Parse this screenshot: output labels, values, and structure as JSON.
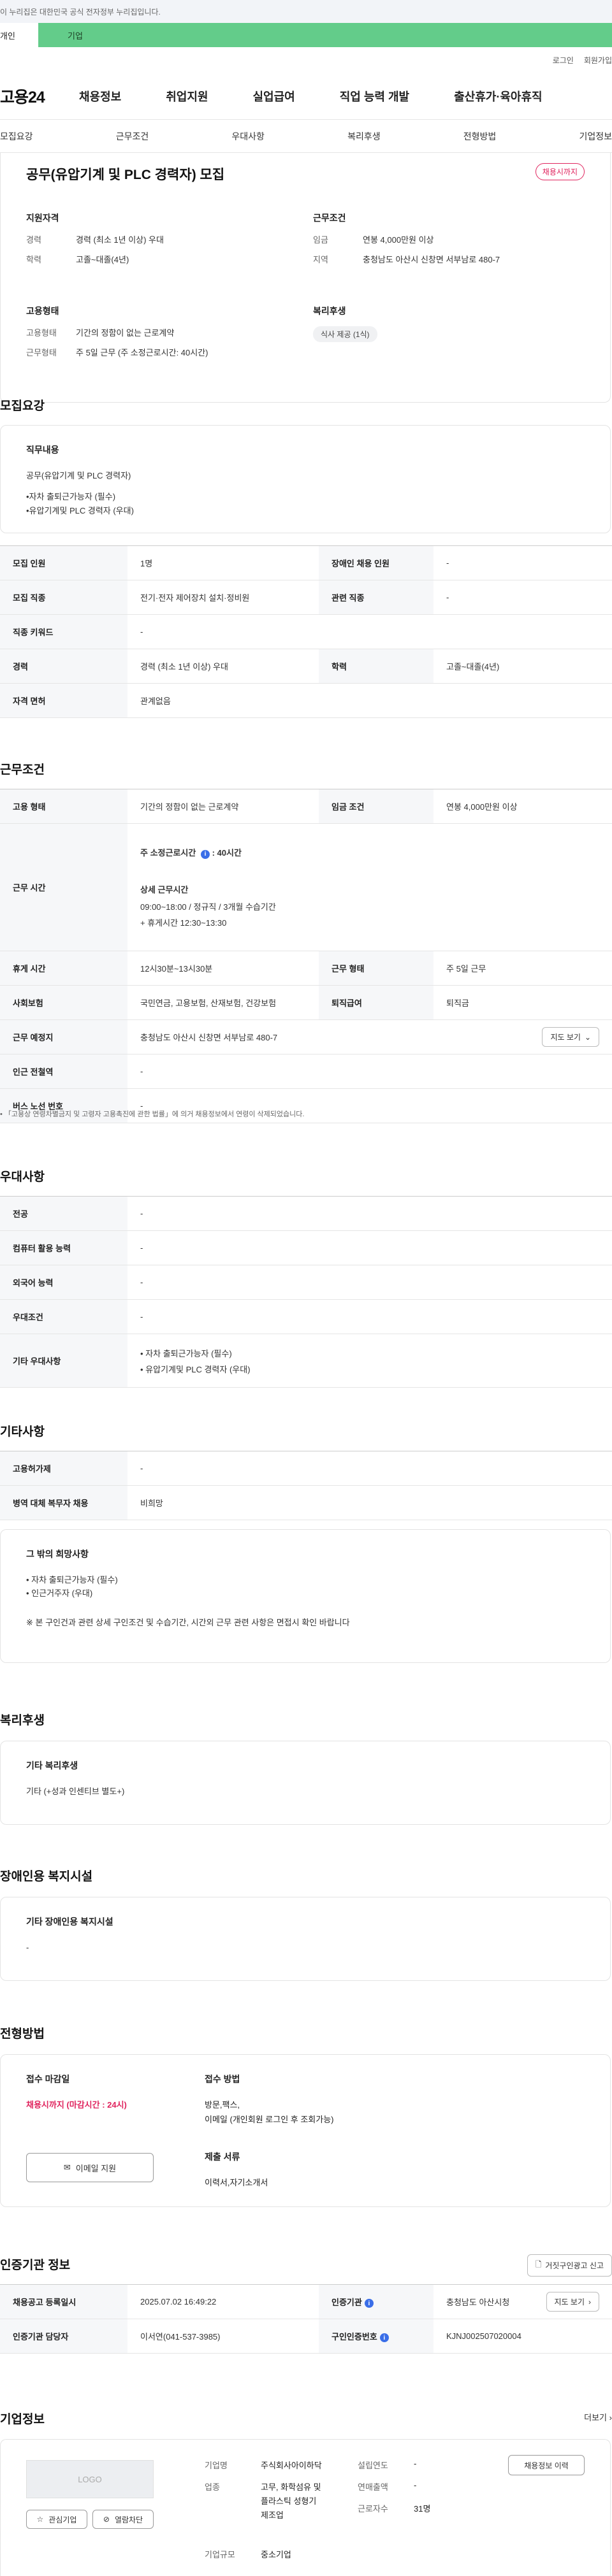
{
  "notice": "이 누리집은 대한민국 공식 전자정부 누리집입니다.",
  "user_tabs": {
    "personal": "개인",
    "business": "기업"
  },
  "util": {
    "login": "로그인",
    "join": "회원가입"
  },
  "logo": "고용24",
  "gnb": [
    "채용정보",
    "취업지원",
    "실업급여",
    "직업 능력 개발",
    "출산휴가·육아휴직"
  ],
  "subtabs": [
    "모집요강",
    "근무조건",
    "우대사항",
    "복리후생",
    "전형방법",
    "기업정보"
  ],
  "summary": {
    "title": "공무(유압기계 및 PLC 경력자) 모집",
    "badge": "채용시까지",
    "qual_title": "지원자격",
    "qual": [
      {
        "k": "경력",
        "v": "경력 (최소 1년 이상) 우대"
      },
      {
        "k": "학력",
        "v": "고졸~대졸(4년)"
      }
    ],
    "cond_title": "근무조건",
    "cond": [
      {
        "k": "임금",
        "v": "연봉 4,000만원 이상"
      },
      {
        "k": "지역",
        "v": "충청남도 아산시 신창면 서부남로 480-7"
      }
    ],
    "emp_title": "고용형태",
    "emp": [
      {
        "k": "고용형태",
        "v": "기간의 정함이 없는 근로계약"
      },
      {
        "k": "근무형태",
        "v": "주 5일 근무 (주 소정근로시간: 40시간)"
      }
    ],
    "welfare_title": "복리후생",
    "welfare_chip": "식사 제공 (1식)"
  },
  "recruit": {
    "title": "모집요강",
    "duty_title": "직무내용",
    "duty_lines": [
      "공무(유압기계 및 PLC 경력자)",
      "•자차 출퇴근가능자 (필수)",
      "•유압기계및 PLC 경력자 (우대)"
    ],
    "rows": [
      {
        "k1": "모집 인원",
        "v1": "1명",
        "k2": "장애인 채용 인원",
        "v2": "-"
      },
      {
        "k1": "모집 직종",
        "v1": "전기·전자 제어장치 설치·정비원",
        "k2": "관련 직종",
        "v2": "-"
      },
      {
        "k1": "직종 키워드",
        "v1": "-"
      },
      {
        "k1": "경력",
        "v1": "경력 (최소 1년 이상) 우대",
        "k2": "학력",
        "v2": "고졸~대졸(4년)"
      },
      {
        "k1": "자격 면허",
        "v1": "관계없음"
      }
    ]
  },
  "work": {
    "title": "근무조건",
    "emp_k": "고용 형태",
    "emp_v": "기간의 정함이 없는 근로계약",
    "wage_k": "임금 조건",
    "wage_v": "연봉 4,000만원 이상",
    "time_k": "근무 시간",
    "time_weekly": "주 소정근로시간",
    "time_weekly_v": ": 40시간",
    "time_detail_title": "상세 근무시간",
    "time_detail": "09:00~18:00 / 정규직 / 3개월 수습기간",
    "time_break": "+ 휴게시간 12:30~13:30",
    "rest_k": "휴게 시간",
    "rest_v": "12시30분~13시30분",
    "form_k": "근무 형태",
    "form_v": "주 5일 근무",
    "ins_k": "사회보험",
    "ins_v": "국민연금, 고용보험, 산재보험, 건강보험",
    "ret_k": "퇴직급여",
    "ret_v": "퇴직금",
    "place_k": "근무 예정지",
    "place_v": "충청남도 아산시 신창면 서부남로 480-7",
    "map_btn": "지도 보기",
    "station_k": "인근 전철역",
    "station_v": "-",
    "bus_k": "버스 노선 번호",
    "bus_v": "-",
    "footnote": "「고용상 연령차별금지 및 고령자 고용촉진에 관한 법률」에 의거 채용정보에서 연령이 삭제되었습니다."
  },
  "pref": {
    "title": "우대사항",
    "rows": [
      {
        "k": "전공",
        "v": "-"
      },
      {
        "k": "컴퓨터 활용 능력",
        "v": "-"
      },
      {
        "k": "외국어 능력",
        "v": "-"
      },
      {
        "k": "우대조건",
        "v": "-"
      }
    ],
    "etc_k": "기타 우대사항",
    "etc_lines": [
      "• 자차 출퇴근가능자 (필수)",
      "• 유압기계및 PLC 경력자 (우대)"
    ]
  },
  "other": {
    "title": "기타사항",
    "rows": [
      {
        "k": "고용허가제",
        "v": "-"
      },
      {
        "k": "병역 대체 복무자 채용",
        "v": "비희망"
      }
    ],
    "wish_title": "그 밖의 희망사항",
    "wish_lines": [
      "• 자차 출퇴근가능자 (필수)",
      "• 인근거주자 (우대)"
    ],
    "wish_note": "※ 본 구인건과 관련 상세 구인조건 및 수습기간, 시간외 근무 관련 사항은 면접시 확인 바랍니다"
  },
  "benefit": {
    "title": "복리후생",
    "sub": "기타 복리후생",
    "text": "기타 (+성과 인센티브 별도+)"
  },
  "disab": {
    "title": "장애인용 복지시설",
    "sub": "기타 장애인용 복지시설",
    "text": "-"
  },
  "selection": {
    "title": "전형방법",
    "deadline_title": "접수 마감일",
    "deadline": "채용시까지 (마감시간 : 24시)",
    "email_btn": "이메일 지원",
    "method_title": "접수 방법",
    "method_lines": [
      "방문,팩스,",
      "이메일 (개인회원 로그인 후 조회가능)"
    ],
    "docs_title": "제출 서류",
    "docs": "이력서,자기소개서"
  },
  "agency": {
    "title": "인증기관 정보",
    "report_btn": "거짓구인광고 신고",
    "reg_k": "채용공고 등록일시",
    "reg_v": "2025.07.02 16:49:22",
    "agency_k": "인증기관",
    "agency_v": "충청남도 아산시청",
    "map_btn": "지도 보기",
    "contact_k": "인증기관 담당자",
    "contact_v": "이서연(041-537-3985)",
    "cert_k": "구인인증번호",
    "cert_v": "KJNJ002507020004"
  },
  "company": {
    "title": "기업정보",
    "more": "더보기",
    "logo": "LOGO",
    "fav_btn": "관심기업",
    "block_btn": "열람차단",
    "name_k": "기업명",
    "name_v": "주식회사아이하닥",
    "ind_k": "업종",
    "ind_v": [
      "고무, 화학섬유 및",
      "플라스틱 성형기",
      "제조업"
    ],
    "size_k": "기업규모",
    "size_v": "중소기업",
    "est_k": "설립연도",
    "est_v": "-",
    "sales_k": "연매출액",
    "sales_v": "-",
    "staff_k": "근로자수",
    "staff_v": "31명",
    "history_btn": "채용정보 이력"
  }
}
